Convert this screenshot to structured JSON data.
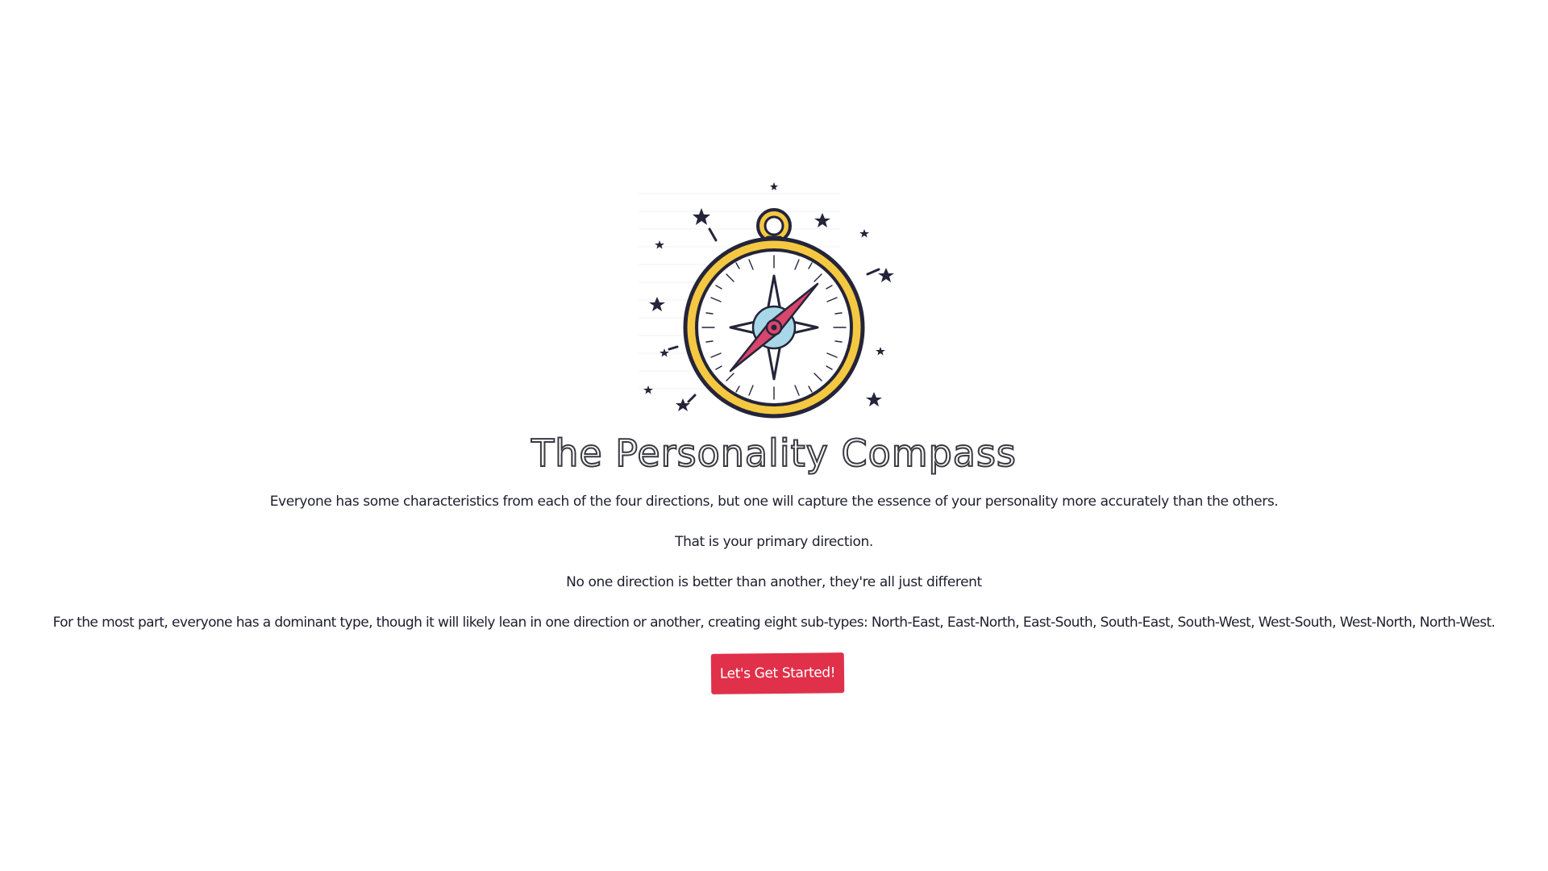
{
  "hero": {
    "logo_icon": "compass-icon",
    "title": "The Personality Compass"
  },
  "intro": {
    "paragraph_1": "Everyone has some characteristics from each of the four directions, but one will capture the essence of your personality more accurately than the others.",
    "paragraph_2": "That is your primary direction.",
    "paragraph_3": "No one direction is better than another, they're all just different",
    "paragraph_4": "For the most part, everyone has a dominant type, though it will likely lean in one direction or another, creating eight sub-types: North-East, East-North, East-South, South-East, South-West, West-South, West-North, North-West."
  },
  "cta": {
    "label": "Let's Get Started!"
  },
  "colors": {
    "accent": "#e0304a",
    "compass_ring": "#f5c842",
    "compass_needle": "#d9466b",
    "compass_center": "#a8d8e8",
    "ink": "#1e1e2e"
  }
}
